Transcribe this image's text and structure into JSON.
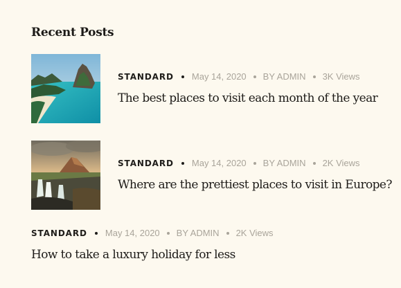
{
  "widget": {
    "title": "Recent Posts"
  },
  "posts": [
    {
      "category": "STANDARD",
      "date": "May 14, 2020",
      "author": "BY ADMIN",
      "views": "3K Views",
      "title": "The best places to visit each month of the year",
      "thumbnail": "tropical-island-lagoon"
    },
    {
      "category": "STANDARD",
      "date": "May 14, 2020",
      "author": "BY ADMIN",
      "views": "2K Views",
      "title": "Where are the prettiest places to visit in Europe?",
      "thumbnail": "mountain-waterfall-sunset"
    },
    {
      "category": "STANDARD",
      "date": "May 14, 2020",
      "author": "BY ADMIN",
      "views": "2K Views",
      "title": "How to take a luxury holiday for less"
    }
  ]
}
